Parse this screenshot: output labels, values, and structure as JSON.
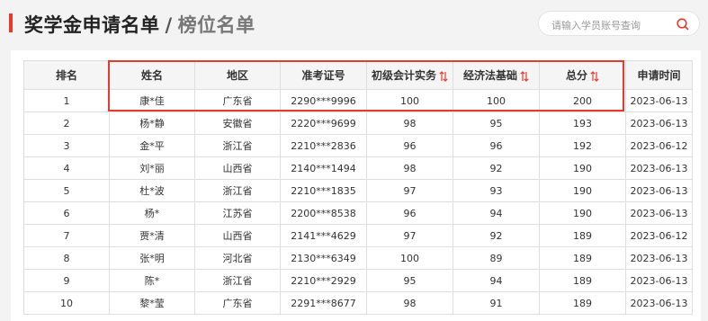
{
  "header": {
    "title": "奖学金申请名单",
    "separator": "/",
    "subtitle": "榜位名单",
    "accent_color": "#e8392f"
  },
  "search": {
    "placeholder": "请输入学员账号查询",
    "icon": "search-icon"
  },
  "table": {
    "columns": [
      "排名",
      "姓名",
      "地区",
      "准考证号",
      "初级会计实务",
      "经济法基础",
      "总分",
      "申请时间"
    ],
    "sortable_columns": [
      "初级会计实务",
      "经济法基础",
      "总分"
    ],
    "sort_icon": "sort-updown-icon",
    "rows": [
      [
        "1",
        "康*佳",
        "广东省",
        "2290***9996",
        "100",
        "100",
        "200",
        "2023-06-13"
      ],
      [
        "2",
        "杨*静",
        "安徽省",
        "2220***9699",
        "98",
        "95",
        "193",
        "2023-06-13"
      ],
      [
        "3",
        "金*平",
        "浙江省",
        "2210***2836",
        "96",
        "96",
        "192",
        "2023-06-12"
      ],
      [
        "4",
        "刘*丽",
        "山西省",
        "2140***1494",
        "98",
        "92",
        "190",
        "2023-06-13"
      ],
      [
        "5",
        "杜*波",
        "浙江省",
        "2210***1835",
        "97",
        "93",
        "190",
        "2023-06-13"
      ],
      [
        "6",
        "杨*",
        "江苏省",
        "2200***8538",
        "96",
        "94",
        "190",
        "2023-06-13"
      ],
      [
        "7",
        "贾*清",
        "山西省",
        "2141***4629",
        "97",
        "92",
        "189",
        "2023-06-12"
      ],
      [
        "8",
        "张*明",
        "河北省",
        "2130***6349",
        "100",
        "89",
        "189",
        "2023-06-13"
      ],
      [
        "9",
        "陈*",
        "浙江省",
        "2210***2929",
        "95",
        "94",
        "189",
        "2023-06-13"
      ],
      [
        "10",
        "黎*莹",
        "广东省",
        "2291***8677",
        "98",
        "91",
        "189",
        "2023-06-13"
      ]
    ]
  },
  "highlight_color": "#e8392f"
}
